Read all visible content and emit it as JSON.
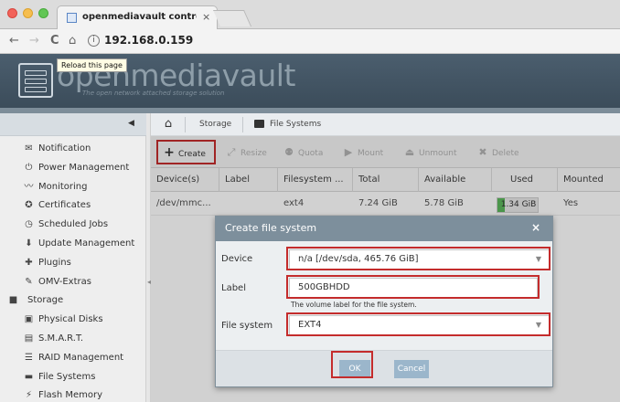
{
  "browser": {
    "tab_title": "openmediavault control panel",
    "tab_close": "×",
    "url": "192.168.0.159",
    "back": "←",
    "forward": "→",
    "reload": "C",
    "home": "⌂",
    "info": "i",
    "tooltip": "Reload this page"
  },
  "header": {
    "logo_name": "openmediavault",
    "logo_tagline": "The open network attached storage solution"
  },
  "breadcrumb": {
    "items": [
      "Storage",
      "File Systems"
    ]
  },
  "sidebar": {
    "items": [
      {
        "label": "Notification",
        "icon": "envelope-icon",
        "glyph": "✉"
      },
      {
        "label": "Power Management",
        "icon": "power-icon",
        "glyph": "⏻"
      },
      {
        "label": "Monitoring",
        "icon": "chart-icon",
        "glyph": "〰"
      },
      {
        "label": "Certificates",
        "icon": "certificate-icon",
        "glyph": "✪"
      },
      {
        "label": "Scheduled Jobs",
        "icon": "clock-icon",
        "glyph": "◷"
      },
      {
        "label": "Update Management",
        "icon": "update-icon",
        "glyph": "⬇"
      },
      {
        "label": "Plugins",
        "icon": "puzzle-icon",
        "glyph": "✚"
      },
      {
        "label": "OMV-Extras",
        "icon": "wrench-icon",
        "glyph": "✎"
      },
      {
        "label": "Storage",
        "icon": "storage-icon",
        "glyph": "■",
        "section": true
      },
      {
        "label": "Physical Disks",
        "icon": "disk-icon",
        "glyph": "▣"
      },
      {
        "label": "S.M.A.R.T.",
        "icon": "smart-icon",
        "glyph": "▤"
      },
      {
        "label": "RAID Management",
        "icon": "raid-icon",
        "glyph": "☰"
      },
      {
        "label": "File Systems",
        "icon": "folder-icon",
        "glyph": "▬"
      },
      {
        "label": "Flash Memory",
        "icon": "flash-icon",
        "glyph": "⚡"
      }
    ]
  },
  "toolbar": {
    "create": "Create",
    "resize": "Resize",
    "quota": "Quota",
    "mount": "Mount",
    "unmount": "Unmount",
    "delete": "Delete"
  },
  "grid": {
    "columns": [
      "Device(s)",
      "Label",
      "Filesystem ...",
      "Total",
      "Available",
      "Used",
      "Mounted"
    ],
    "rows": [
      {
        "device": "/dev/mmc...",
        "label": "",
        "filesystem": "ext4",
        "total": "7.24 GiB",
        "available": "5.78 GiB",
        "used": "1.34 GiB",
        "used_fraction": 0.19,
        "mounted": "Yes"
      }
    ]
  },
  "dialog": {
    "title": "Create file system",
    "close": "×",
    "device_label": "Device",
    "device_value": "n/a [/dev/sda, 465.76 GiB]",
    "label_label": "Label",
    "label_value": "500GBHDD",
    "label_note": "The volume label for the file system.",
    "fs_label": "File system",
    "fs_value": "EXT4",
    "ok": "OK",
    "cancel": "Cancel"
  },
  "colors": {
    "highlight": "#c42c2c",
    "header_bg": "#4b5e6e",
    "dialog_title": "#7d8f9c",
    "used_bar": "#5cb85c"
  }
}
